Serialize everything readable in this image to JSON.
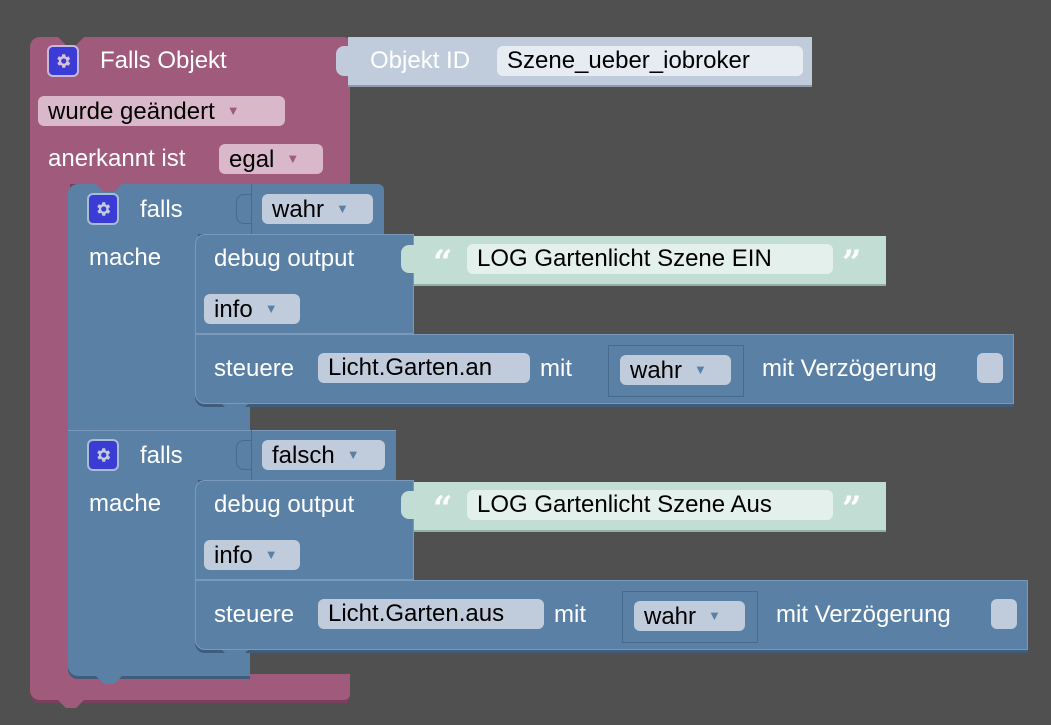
{
  "trigger_block": {
    "title": "Falls Objekt",
    "object_id_label": "Objekt ID",
    "object_id_value": "Szene_ueber_iobroker",
    "condition_dropdown": "wurde geändert",
    "ack_label": "anerkannt ist",
    "ack_dropdown": "egal"
  },
  "if_blocks": [
    {
      "falls_label": "falls",
      "condition_value": "wahr",
      "mache_label": "mache",
      "debug": {
        "label": "debug output",
        "text": "LOG Gartenlicht Szene EIN",
        "level": "info"
      },
      "control": {
        "label": "steuere",
        "object": "Licht.Garten.an",
        "with_label": "mit",
        "value": "wahr",
        "delay_label": "mit Verzögerung",
        "delay_checked": false
      }
    },
    {
      "falls_label": "falls",
      "condition_value": "falsch",
      "mache_label": "mache",
      "debug": {
        "label": "debug output",
        "text": "LOG Gartenlicht Szene Aus",
        "level": "info"
      },
      "control": {
        "label": "steuere",
        "object": "Licht.Garten.aus",
        "with_label": "mit",
        "value": "wahr",
        "delay_label": "mit Verzögerung",
        "delay_checked": false
      }
    }
  ],
  "icons": {
    "gear": "gear-icon",
    "dropdown": "▼",
    "quote_open": "“",
    "quote_close": "”"
  },
  "colors": {
    "workspace": "#505050",
    "event_block": "#a05a7c",
    "logic_block": "#5b80a5",
    "text_block": "#c1ddd4",
    "id_block": "#c0ccdc",
    "gear_bg": "#3b3bd6"
  }
}
